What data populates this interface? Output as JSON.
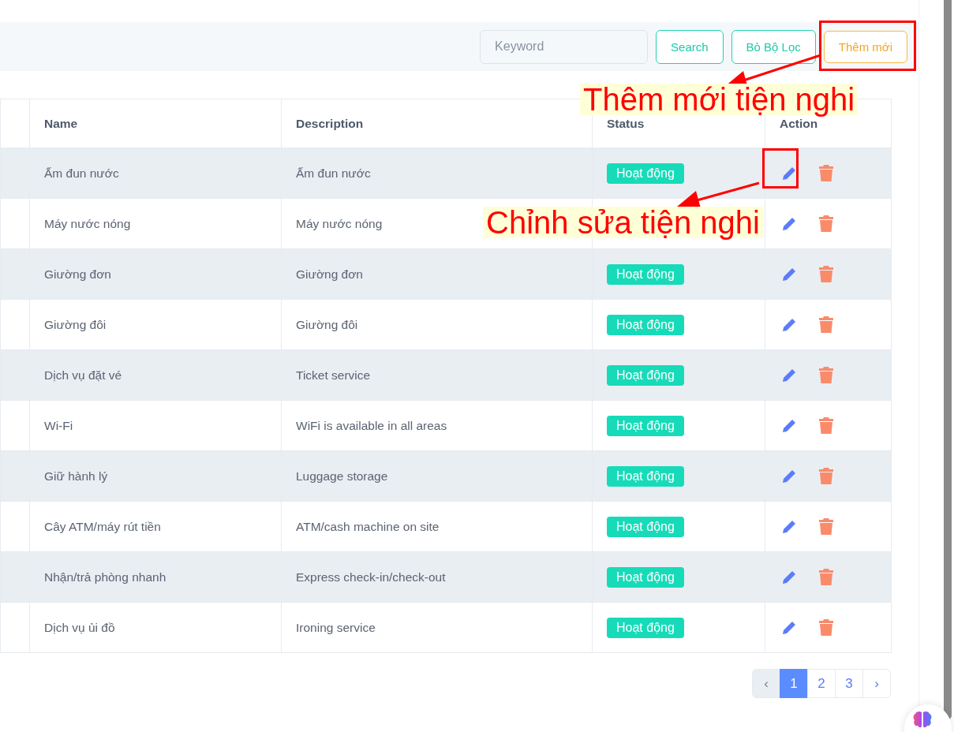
{
  "toolbar": {
    "search_field": {
      "placeholder": "Keyword"
    },
    "buttons": [
      {
        "label": "Search",
        "kind": "outline"
      },
      {
        "label": "Bỏ Bộ Lọc",
        "kind": "outline"
      },
      {
        "label": "Thêm mới",
        "kind": "add"
      }
    ]
  },
  "table": {
    "columns": [
      "Name",
      "Description",
      "Status",
      "Action"
    ],
    "rows": [
      {
        "name": "Ấm đun nước",
        "description": "Ấm đun nước",
        "status": "Hoạt động"
      },
      {
        "name": "Máy nước nóng",
        "description": "Máy nước nóng"
      },
      {
        "name": "Giường đơn",
        "description": "Giường đơn",
        "status": "Hoạt động"
      },
      {
        "name": "Giường đôi",
        "description": "Giường đôi",
        "status": "Hoạt động"
      },
      {
        "name": "Dịch vụ đặt vé",
        "description": "Ticket service",
        "status": "Hoạt động"
      },
      {
        "name": "Wi-Fi",
        "description": "WiFi is available in all areas",
        "status": "Hoạt động"
      },
      {
        "name": "Giữ hành lý",
        "description": "Luggage storage",
        "status": "Hoạt động"
      },
      {
        "name": "Cây ATM/máy rút tiền",
        "description": "ATM/cash machine on site",
        "status": "Hoạt động"
      },
      {
        "name": "Nhận/trả phòng nhanh",
        "description": "Express check-in/check-out",
        "status": "Hoạt động"
      },
      {
        "name": "Dịch vụ ủi đồ",
        "description": "Ironing service",
        "status": "Hoạt động"
      }
    ]
  },
  "pagination": {
    "prev": "‹",
    "pages": [
      {
        "label": "1",
        "selected": true
      },
      {
        "label": "2",
        "selected": false
      },
      {
        "label": "3",
        "selected": false
      }
    ],
    "next": "›"
  },
  "annotations": [
    {
      "label": "Thêm mới tiện nghi"
    },
    {
      "label": "Chỉnh sửa tiện nghi"
    }
  ]
}
